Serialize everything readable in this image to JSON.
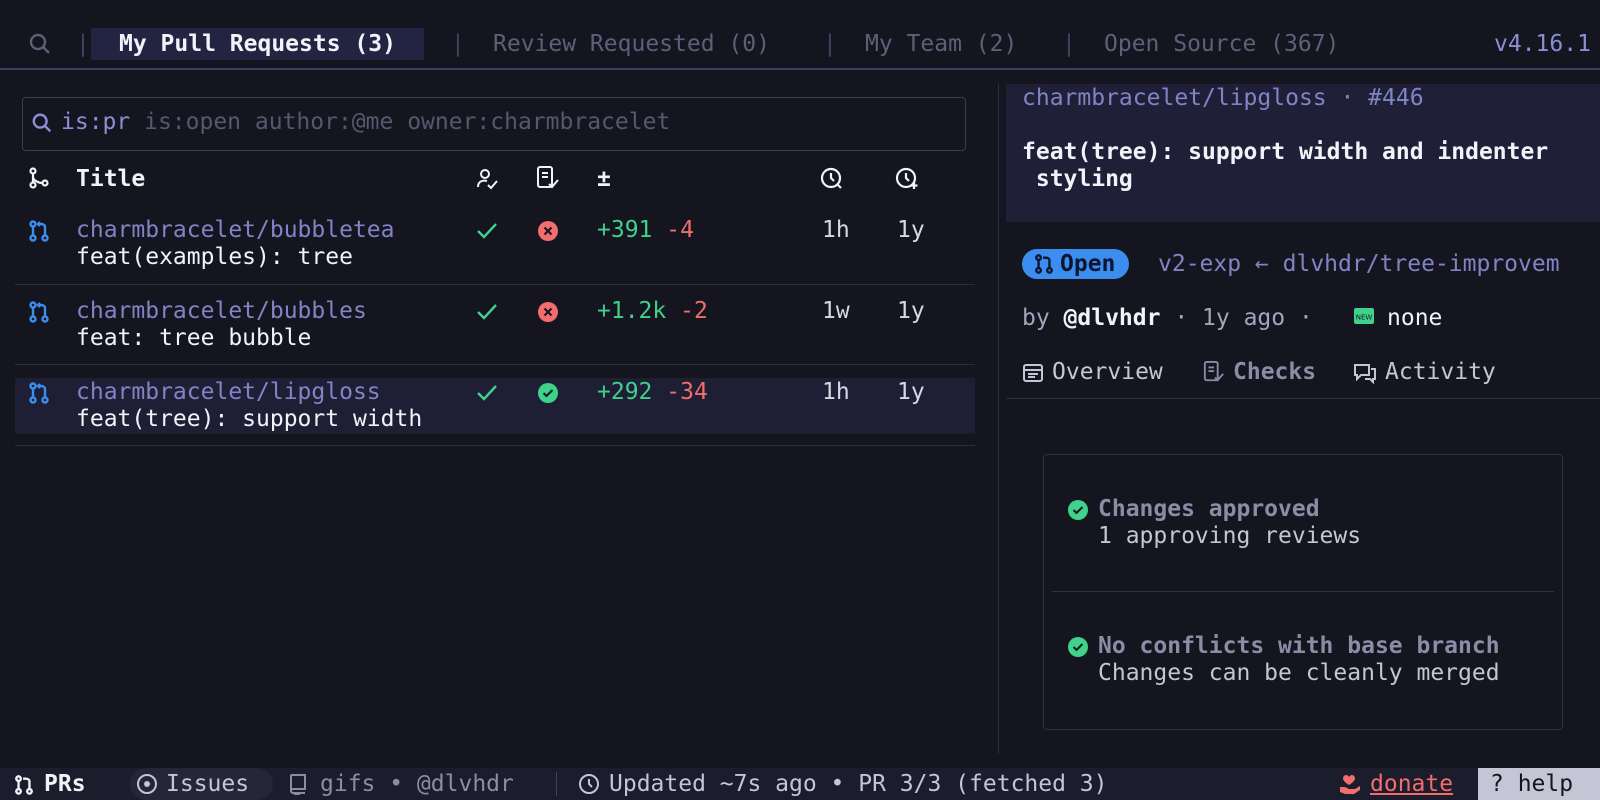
{
  "tabs": {
    "items": [
      {
        "label": "My Pull Requests (3)"
      },
      {
        "label": "Review Requested (0)"
      },
      {
        "label": "My Team (2)"
      },
      {
        "label": "Open Source (367)"
      }
    ],
    "separator": "|",
    "version": "v4.16.1"
  },
  "search": {
    "prefix": "is:pr",
    "rest": " is:open author:@me owner:charmbracelet"
  },
  "table": {
    "columns": {
      "title": "Title",
      "diff": "±"
    },
    "rows": [
      {
        "repo": "charmbracelet/bubbletea",
        "title": "feat(examples): tree",
        "additions": "+391",
        "deletions": "-4",
        "updated": "1h",
        "created": "1y",
        "ci": "fail"
      },
      {
        "repo": "charmbracelet/bubbles",
        "title": "feat: tree bubble",
        "additions": "+1.2k",
        "deletions": "-2",
        "updated": "1w",
        "created": "1y",
        "ci": "fail"
      },
      {
        "repo": "charmbracelet/lipgloss",
        "title": "feat(tree): support width",
        "additions": "+292",
        "deletions": "-34",
        "updated": "1h",
        "created": "1y",
        "ci": "pass"
      }
    ]
  },
  "detail": {
    "repo_line": "charmbracelet/lipgloss · #446",
    "title_line1": "feat(tree): support width and indenter",
    "title_line2": " styling",
    "state": "Open",
    "branches": "v2-exp ← dlvhdr/tree-improvem",
    "by_prefix": "by ",
    "author": "@dlvhdr",
    "age": " · 1y ago · ",
    "labels": "none",
    "tabs": [
      "Overview",
      "Checks",
      "Activity"
    ],
    "checks": [
      {
        "title": "Changes approved",
        "subtitle": "1 approving reviews"
      },
      {
        "title": "No conflicts with base branch",
        "subtitle": "Changes can be cleanly merged"
      }
    ]
  },
  "status": {
    "prs": "PRs",
    "issues": "Issues",
    "repo": "gifs • @dlvhdr",
    "updated": "Updated ~7s ago • PR 3/3 (fetched 3)",
    "donate": "donate",
    "help": "? help"
  },
  "colors": {
    "accent": "#8184c4",
    "add": "#3fd28a",
    "del": "#f26d6d",
    "open": "#3b8df0"
  }
}
